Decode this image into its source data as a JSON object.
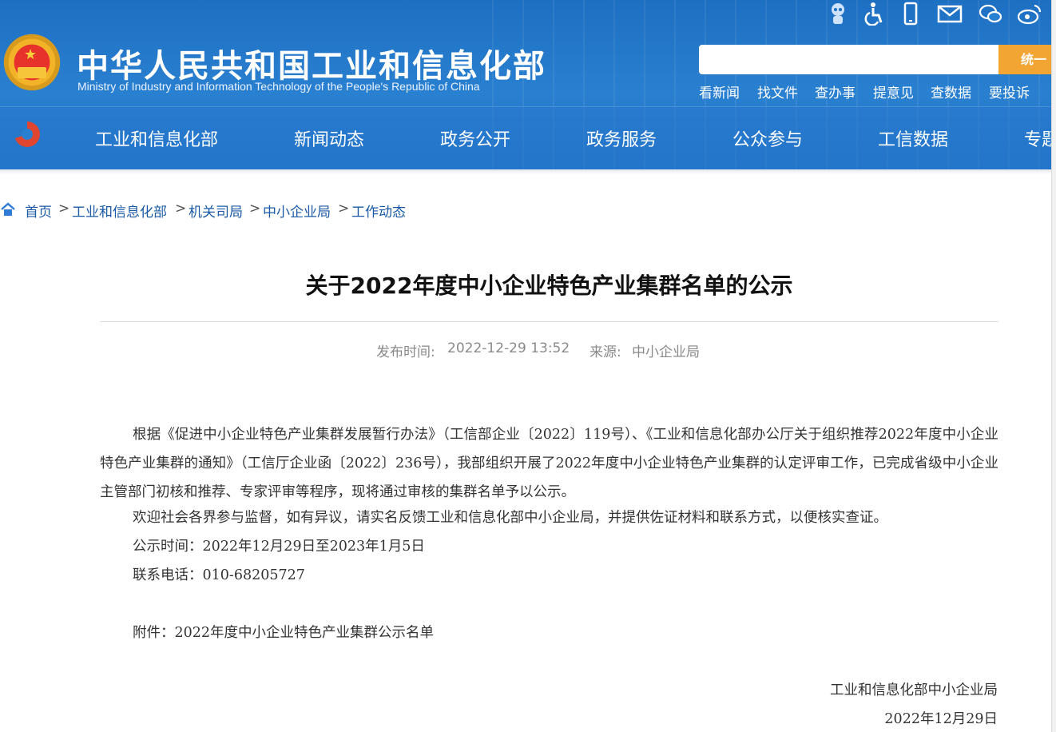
{
  "header": {
    "ministry_cn": "中华人民共和国工业和信息化部",
    "ministry_en": "Ministry of Industry and Information Technology of the People's Republic of China",
    "icons": [
      "robot-icon",
      "accessibility-icon",
      "mobile-icon",
      "mail-icon",
      "wechat-icon",
      "weibo-icon"
    ],
    "search_button": "统一",
    "quick_links": [
      "看新闻",
      "找文件",
      "查办事",
      "提意见",
      "查数据",
      "要投诉"
    ],
    "nav": [
      "工业和信息化部",
      "新闻动态",
      "政务公开",
      "政务服务",
      "公众参与",
      "工信数据",
      "专题"
    ]
  },
  "breadcrumb": {
    "items": [
      "首页",
      "工业和信息化部",
      "机关司局",
      "中小企业局",
      "工作动态"
    ],
    "separator": ">"
  },
  "article": {
    "title": "关于2022年度中小企业特色产业集群名单的公示",
    "publish_label": "发布时间:",
    "publish_time": "2022-12-29 13:52",
    "source_label": "来源:",
    "source": "中小企业局",
    "para1": "根据《促进中小企业特色产业集群发展暂行办法》（工信部企业〔2022〕119号）、《工业和信息化部办公厅关于组织推荐2022年度中小企业特色产业集群的通知》（工信厅企业函〔2022〕236号），我部组织开展了2022年度中小企业特色产业集群的认定评审工作，已完成省级中小企业主管部门初核和推荐、专家评审等程序，现将通过审核的集群名单予以公示。",
    "para2": "欢迎社会各界参与监督，如有异议，请实名反馈工业和信息化部中小企业局，并提供佐证材料和联系方式，以便核实查证。",
    "period": "公示时间：2022年12月29日至2023年1月5日",
    "phone": "联系电话：010-68205727",
    "attachment": "附件：2022年度中小企业特色产业集群公示名单",
    "signature": "工业和信息化部中小企业局",
    "date": "2022年12月29日"
  },
  "colors": {
    "header_blue": "#2a80d0",
    "search_orange": "#f2a533",
    "link_blue": "#1a5aa6"
  }
}
